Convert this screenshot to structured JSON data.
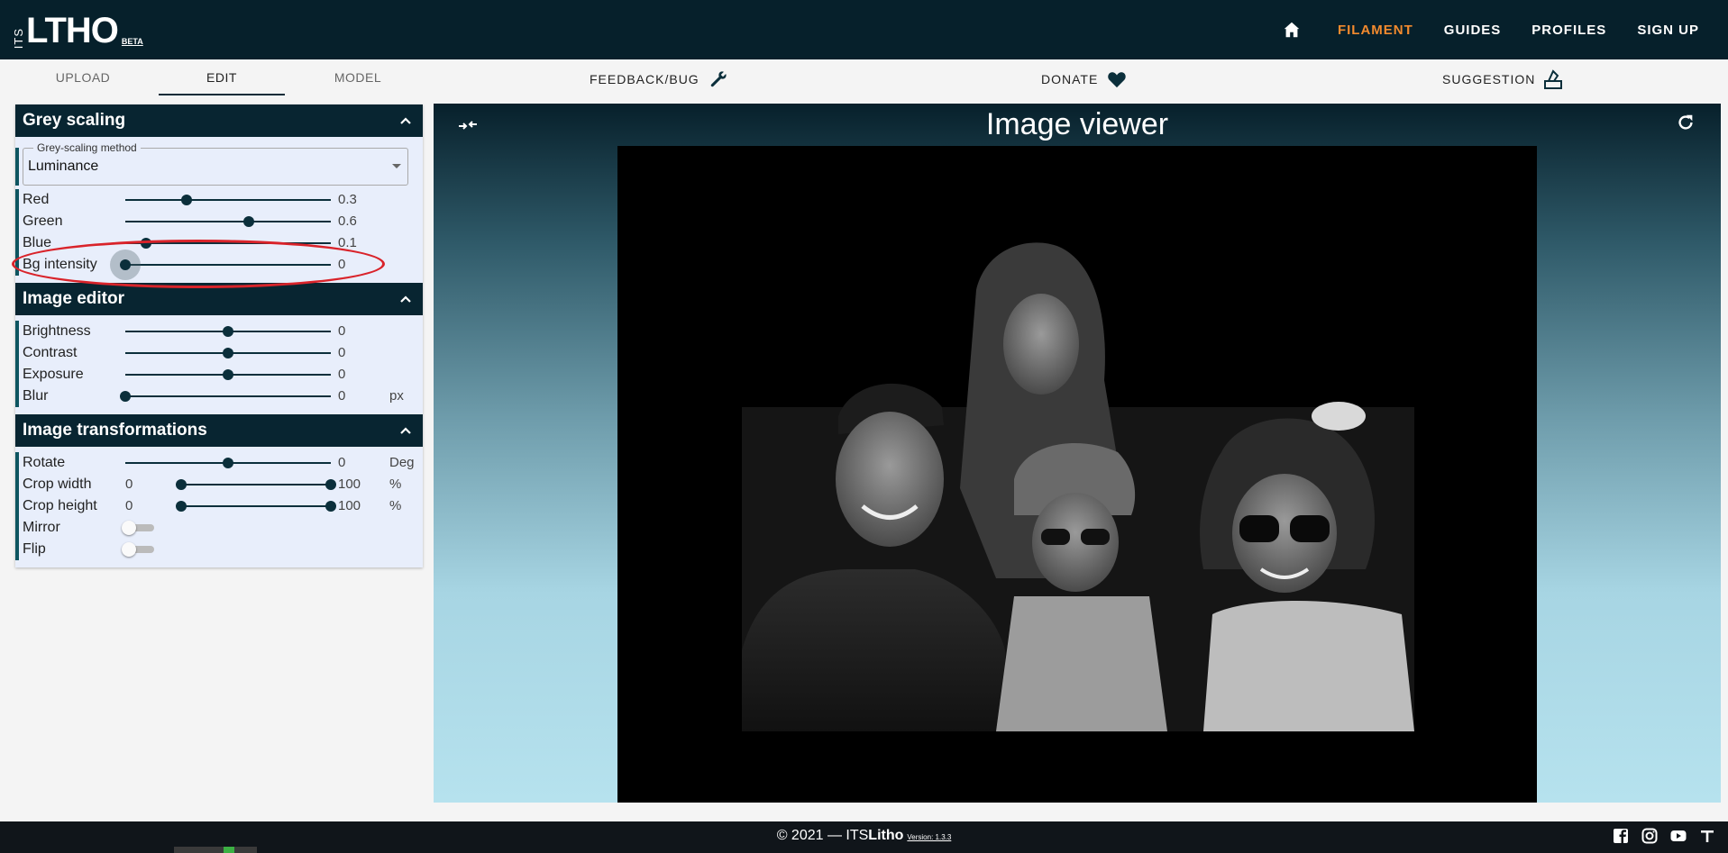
{
  "app": {
    "logo_prefix": "ITS",
    "logo_main": "LTHO",
    "logo_badge": "BETA"
  },
  "nav": {
    "items": [
      "FILAMENT",
      "GUIDES",
      "PROFILES",
      "SIGN UP"
    ],
    "active": "FILAMENT",
    "active_color": "#f28a2e"
  },
  "subnav": {
    "tabs": [
      "UPLOAD",
      "EDIT",
      "MODEL"
    ],
    "active_tab": "EDIT",
    "feedback_label": "FEEDBACK/BUG",
    "donate_label": "DONATE",
    "suggestion_label": "SUGGESTION"
  },
  "grey_scaling": {
    "title": "Grey scaling",
    "method_label": "Grey-scaling method",
    "method_value": "Luminance",
    "red_label": "Red",
    "red_value": "0.3",
    "red_level": 0.3,
    "green_label": "Green",
    "green_value": "0.6",
    "green_level": 0.6,
    "blue_label": "Blue",
    "blue_value": "0.1",
    "blue_level": 0.1,
    "bg_label": "Bg intensity",
    "bg_value": "0",
    "bg_level": 0
  },
  "image_editor": {
    "title": "Image editor",
    "brightness_label": "Brightness",
    "brightness_value": "0",
    "brightness_level": 0.5,
    "contrast_label": "Contrast",
    "contrast_value": "0",
    "contrast_level": 0.5,
    "exposure_label": "Exposure",
    "exposure_value": "0",
    "exposure_level": 0.5,
    "blur_label": "Blur",
    "blur_value": "0",
    "blur_level": 0,
    "blur_unit": "px"
  },
  "image_transformations": {
    "title": "Image transformations",
    "rotate_label": "Rotate",
    "rotate_value": "0",
    "rotate_level": 0.5,
    "rotate_unit": "Deg",
    "crop_width_label": "Crop width",
    "crop_width_min": "0",
    "crop_width_max": "100",
    "crop_width_unit": "%",
    "crop_height_label": "Crop height",
    "crop_height_min": "0",
    "crop_height_max": "100",
    "crop_height_unit": "%",
    "mirror_label": "Mirror",
    "mirror_on": false,
    "flip_label": "Flip",
    "flip_on": false
  },
  "viewer": {
    "title": "Image viewer"
  },
  "footer": {
    "copyright_prefix": "© 2021 — ITS",
    "copyright_brand": "Litho",
    "version": "Version: 1.3.3"
  },
  "icons": {
    "home": "home-icon",
    "feedback": "wrench-icon",
    "donate": "heart-icon",
    "suggestion": "ballot-icon",
    "collapse": "collapse-arrows-icon",
    "refresh": "refresh-icon",
    "facebook": "facebook-icon",
    "instagram": "instagram-icon",
    "youtube": "youtube-icon",
    "thingiverse": "thingiverse-icon"
  },
  "colors": {
    "nav_bg": "#06202b",
    "section_header": "#082531",
    "slider": "#0b2f3b",
    "annotation": "#d9232a"
  }
}
